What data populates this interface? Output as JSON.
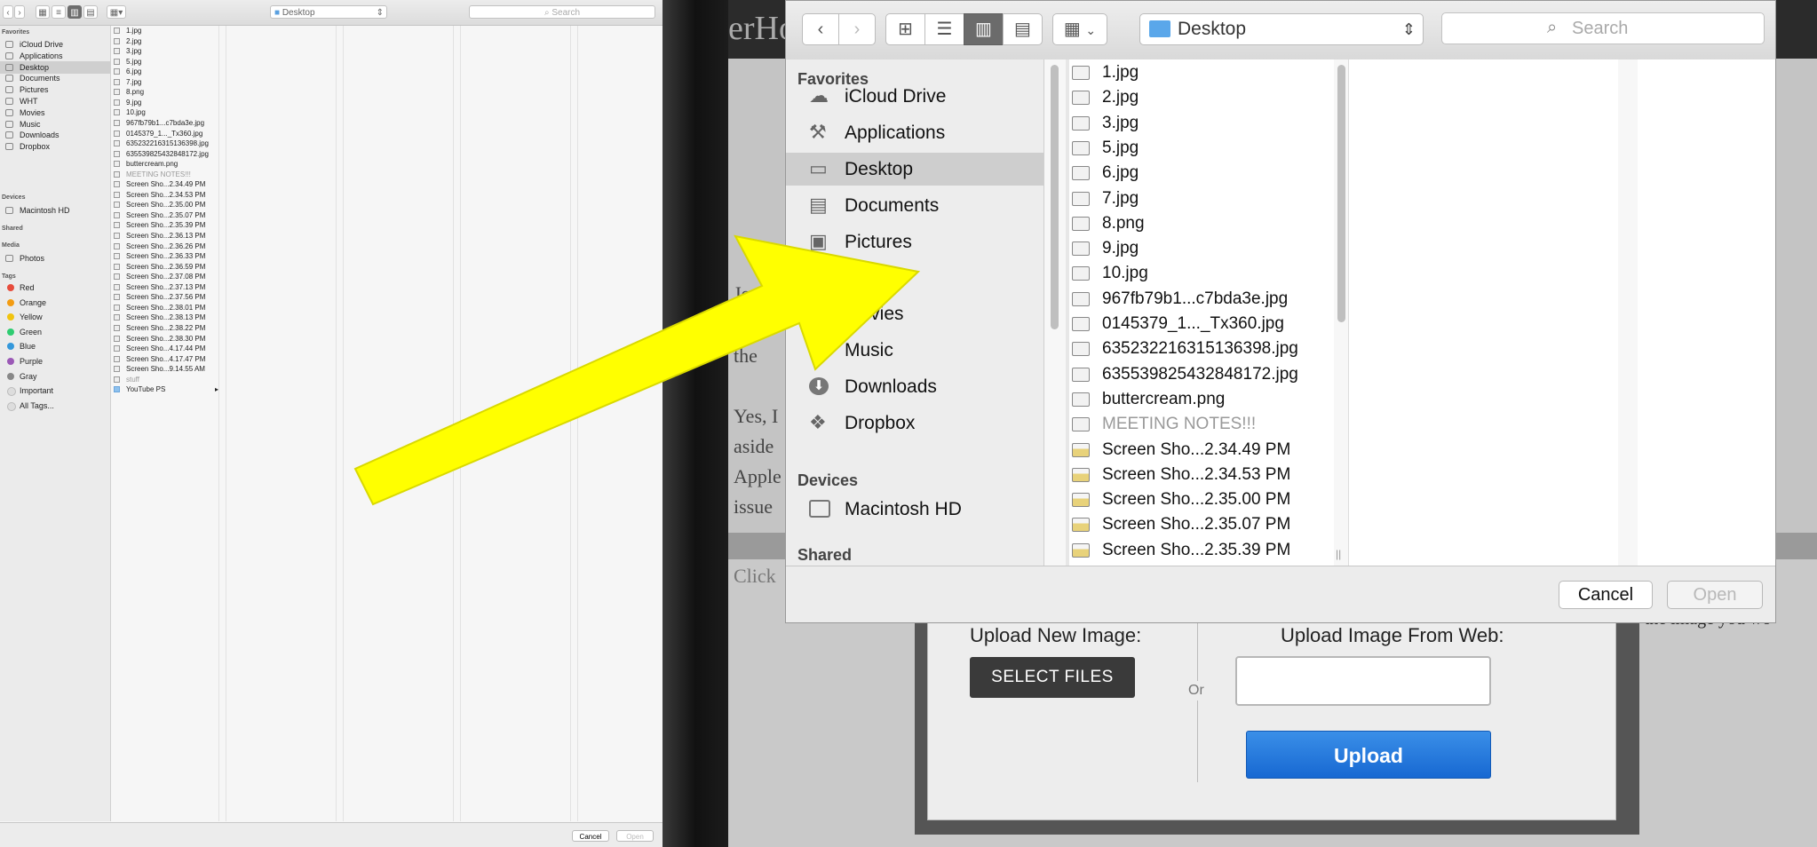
{
  "small_dialog": {
    "path": "Desktop",
    "search_placeholder": "Search",
    "sidebar": {
      "favorites_header": "Favorites",
      "favorites": [
        "iCloud Drive",
        "Applications",
        "Desktop",
        "Documents",
        "Pictures",
        "WHT",
        "Movies",
        "Music",
        "Downloads",
        "Dropbox"
      ],
      "devices_header": "Devices",
      "devices": [
        "Macintosh HD"
      ],
      "shared_header": "Shared",
      "media_header": "Media",
      "media": [
        "Photos"
      ],
      "tags_header": "Tags",
      "tags": [
        {
          "label": "Red",
          "color": "#e74c3c"
        },
        {
          "label": "Orange",
          "color": "#f39c12"
        },
        {
          "label": "Yellow",
          "color": "#f1c40f"
        },
        {
          "label": "Green",
          "color": "#2ecc71"
        },
        {
          "label": "Blue",
          "color": "#3498db"
        },
        {
          "label": "Purple",
          "color": "#9b59b6"
        },
        {
          "label": "Gray",
          "color": "#888888"
        },
        {
          "label": "Important",
          "color": "#dddddd"
        },
        {
          "label": "All Tags...",
          "color": "#dddddd"
        }
      ]
    },
    "files": [
      "1.jpg",
      "2.jpg",
      "3.jpg",
      "5.jpg",
      "6.jpg",
      "7.jpg",
      "8.png",
      "9.jpg",
      "10.jpg",
      "967fb79b1...c7bda3e.jpg",
      "0145379_1..._Tx360.jpg",
      "635232216315136398.jpg",
      "635539825432848172.jpg",
      "buttercream.png",
      "MEETING NOTES!!!",
      "Screen Sho...2.34.49 PM",
      "Screen Sho...2.34.53 PM",
      "Screen Sho...2.35.00 PM",
      "Screen Sho...2.35.07 PM",
      "Screen Sho...2.35.39 PM",
      "Screen Sho...2.36.13 PM",
      "Screen Sho...2.36.26 PM",
      "Screen Sho...2.36.33 PM",
      "Screen Sho...2.36.59 PM",
      "Screen Sho...2.37.08 PM",
      "Screen Sho...2.37.13 PM",
      "Screen Sho...2.37.56 PM",
      "Screen Sho...2.38.01 PM",
      "Screen Sho...2.38.13 PM",
      "Screen Sho...2.38.22 PM",
      "Screen Sho...2.38.30 PM",
      "Screen Sho...4.17.44 PM",
      "Screen Sho...4.17.47 PM",
      "Screen Sho...9.14.55 AM",
      "stuff",
      "YouTube PS"
    ],
    "cancel_label": "Cancel",
    "open_label": "Open"
  },
  "big_dialog": {
    "path": "Desktop",
    "search_placeholder": "Search",
    "sidebar": {
      "favorites_header": "Favorites",
      "favorites": [
        "iCloud Drive",
        "Applications",
        "Desktop",
        "Documents",
        "Pictures",
        "Movies",
        "Music",
        "Downloads",
        "Dropbox"
      ],
      "devices_header": "Devices",
      "devices": [
        "Macintosh HD"
      ],
      "shared_header": "Shared"
    },
    "files": [
      "1.jpg",
      "2.jpg",
      "3.jpg",
      "5.jpg",
      "6.jpg",
      "7.jpg",
      "8.png",
      "9.jpg",
      "10.jpg",
      "967fb79b1...c7bda3e.jpg",
      "0145379_1..._Tx360.jpg",
      "635232216315136398.jpg",
      "635539825432848172.jpg",
      "buttercream.png",
      "MEETING NOTES!!!",
      "Screen Sho...2.34.49 PM",
      "Screen Sho...2.34.53 PM",
      "Screen Sho...2.35.00 PM",
      "Screen Sho...2.35.07 PM",
      "Screen Sho...2.35.39 PM"
    ],
    "cancel_label": "Cancel",
    "open_label": "Open"
  },
  "background_page": {
    "header_fragment": "erHo",
    "text_fragments": [
      "Jo",
      "the",
      "Yes, I",
      "aside",
      "Apple",
      "issue",
      "Click"
    ],
    "right_fragment": "ose the image you wo",
    "upload_new_label": "Upload New Image:",
    "select_files_label": "SELECT FILES",
    "or_label": "Or",
    "upload_web_label": "Upload Image From Web:",
    "upload_button_label": "Upload"
  },
  "colors": {
    "arrow": "#ffff00",
    "upload_blue": "#1f74dc",
    "selection_gray": "#cecece"
  }
}
